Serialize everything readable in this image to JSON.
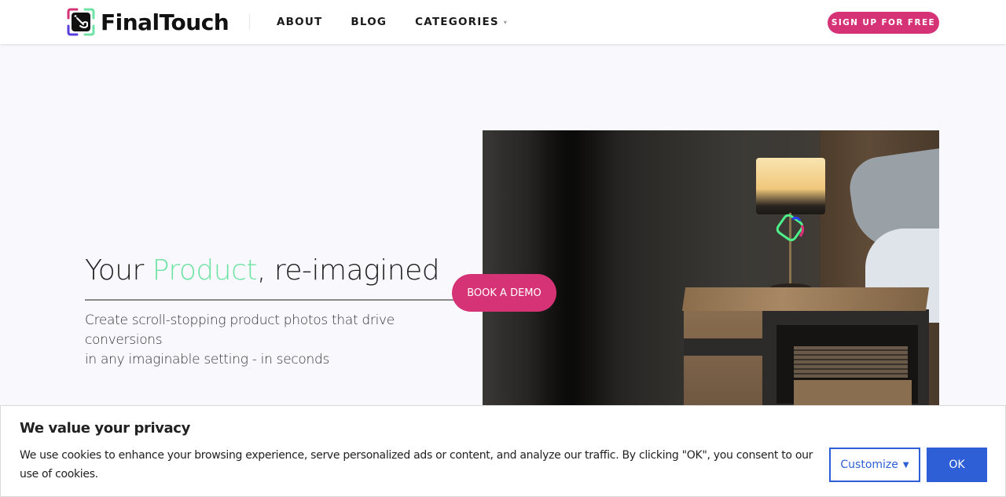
{
  "header": {
    "brand": "FinalTouch",
    "nav": [
      {
        "label": "ABOUT"
      },
      {
        "label": "BLOG"
      },
      {
        "label": "CATEGORIES",
        "has_dropdown": true
      }
    ],
    "signup_label": "SIGN UP FOR FREE"
  },
  "hero": {
    "title_before": "Your ",
    "title_accent": "Product",
    "title_after": ", re-imagined",
    "subtitle_line1": "Create scroll-stopping product photos that drive conversions",
    "subtitle_line2": "in any imaginable setting - in seconds",
    "demo_label": "BOOK A DEMO",
    "image_alt": "Lamp on rustic wooden nightstand beside bed"
  },
  "cookie_banner": {
    "title": "We value your privacy",
    "text": "We use cookies to enhance your browsing experience, serve personalized ads or content, and analyze our traffic. By clicking \"OK\", you consent to our use of cookies.",
    "customize_label": "Customize",
    "ok_label": "OK"
  },
  "icons": {
    "caret_down": "▾",
    "caret_down_filled": "▼"
  },
  "colors": {
    "brand_pink": "#d63377",
    "accent_green": "#6fe3a3",
    "cookie_blue": "#2e5fd6"
  }
}
